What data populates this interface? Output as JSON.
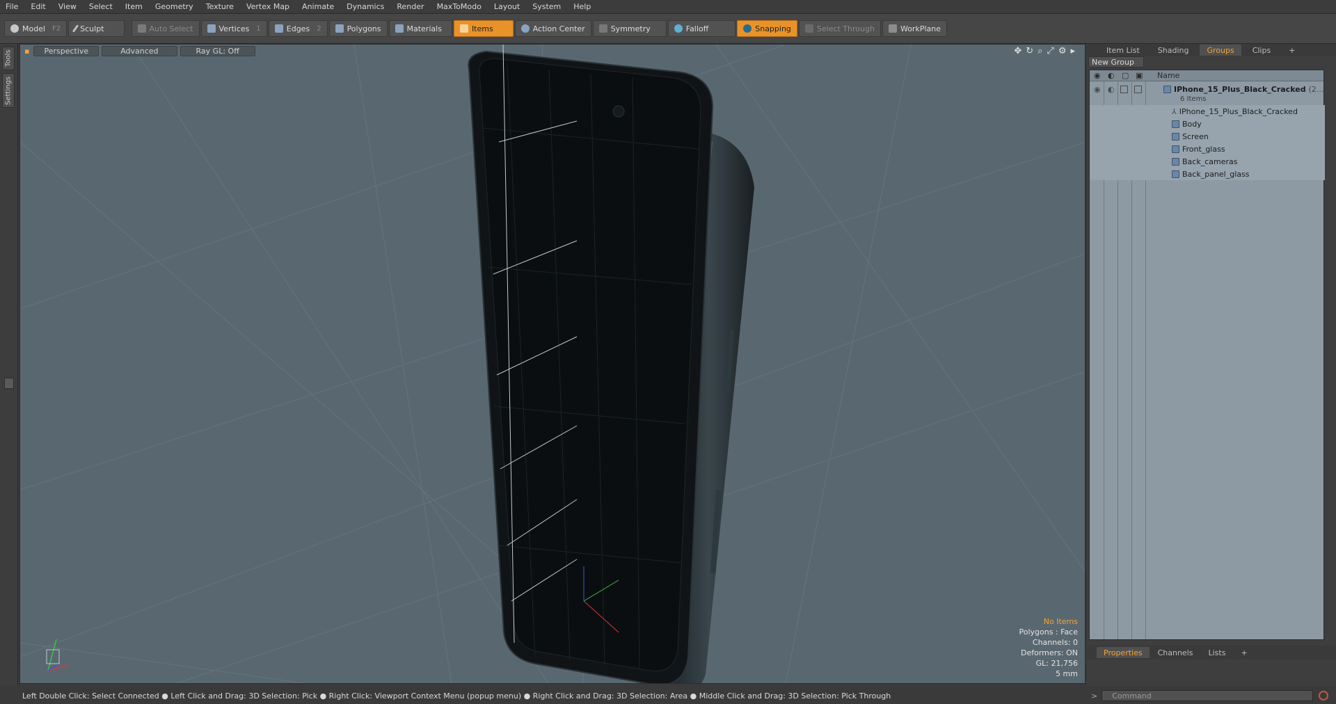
{
  "menu": [
    "File",
    "Edit",
    "View",
    "Select",
    "Item",
    "Geometry",
    "Texture",
    "Vertex Map",
    "Animate",
    "Dynamics",
    "Render",
    "MaxToModo",
    "Layout",
    "System",
    "Help"
  ],
  "toolbar": {
    "model": "Model",
    "model_key": "F2",
    "sculpt": "Sculpt",
    "auto_select": "Auto Select",
    "vertices": "Vertices",
    "vertices_key": "1",
    "edges": "Edges",
    "edges_key": "2",
    "polygons": "Polygons",
    "materials": "Materials",
    "items": "Items",
    "action_center": "Action Center",
    "symmetry": "Symmetry",
    "falloff": "Falloff",
    "snapping": "Snapping",
    "select_through": "Select Through",
    "workplane": "WorkPlane"
  },
  "left_tabs": [
    "Tools",
    "Settings"
  ],
  "viewport": {
    "perspective": "Perspective",
    "advanced": "Advanced",
    "raygl": "Ray GL: Off",
    "info": {
      "items": "No Items",
      "polygons": "Polygons : Face",
      "channels": "Channels: 0",
      "deformers": "Deformers: ON",
      "gl": "GL: 21,756",
      "unit": "5 mm"
    }
  },
  "right_tabs": [
    "Item List",
    "Shading",
    "Groups",
    "Clips"
  ],
  "right_tabs_active": "Groups",
  "new_group": "New Group",
  "group_list": {
    "col_name": "Name",
    "root": "IPhone_15_Plus_Black_Cracked",
    "root_suffix": "(2...",
    "count": "6 Items",
    "children": [
      "IPhone_15_Plus_Black_Cracked",
      "Body",
      "Screen",
      "Front_glass",
      "Back_cameras",
      "Back_panel_glass"
    ]
  },
  "prop_tabs": [
    "Properties",
    "Channels",
    "Lists"
  ],
  "command_placeholder": "Command",
  "status_text": "Left Double Click: Select Connected ● Left Click and Drag: 3D Selection: Pick ● Right Click: Viewport Context Menu (popup menu) ● Right Click and Drag: 3D Selection: Area ● Middle Click and Drag: 3D Selection: Pick Through",
  "colors": {
    "accent": "#e8932a",
    "viewport_bg": "#596870",
    "list_bg": "#8d9aa3"
  }
}
